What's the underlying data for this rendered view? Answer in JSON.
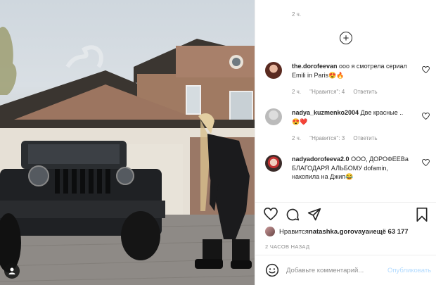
{
  "photo": {
    "alt_label": ""
  },
  "previous_comment": {
    "time": "2 ч."
  },
  "comments": [
    {
      "username": "the.dorofeevan",
      "text": "ооо я смотрела сериал Emili in Paris😍🔥",
      "time": "2 ч.",
      "likes": "\"Нравится\": 4",
      "reply": "Ответить"
    },
    {
      "username": "nadya_kuzmenko2004",
      "text": "Две красные ..😍❤️",
      "time": "2 ч.",
      "likes": "\"Нравится\": 3",
      "reply": "Ответить"
    },
    {
      "username": "nadyadorofeeva2.0",
      "text": "ООО, ДОРОФЕЕВа БЛАГОДАРЯ АЛЬБОМУ dofamin, накопила на Джип😂"
    }
  ],
  "likes_line": {
    "prefix": "Нравится ",
    "user": "natashka.gorovaya",
    "middle": " и ",
    "count": "ещё 63 177"
  },
  "posted_ago": "2 ЧАСОВ НАЗАД",
  "comment_box": {
    "placeholder": "Добавьте комментарий...",
    "publish": "Опубликовать"
  },
  "colors": {
    "accent_disabled": "#b3dbff",
    "meta_gray": "#8e8e8e",
    "text": "#262626"
  },
  "icons": [
    "plus-circle-icon",
    "heart-icon",
    "comment-icon",
    "share-icon",
    "bookmark-icon",
    "emoji-icon",
    "user-tag-icon"
  ]
}
